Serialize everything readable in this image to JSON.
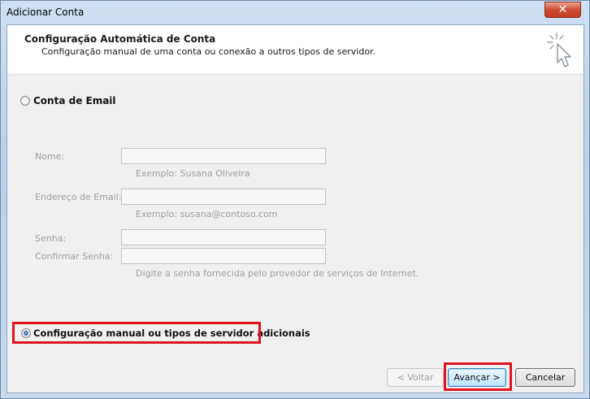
{
  "window": {
    "title": "Adicionar Conta"
  },
  "header": {
    "title": "Configuração Automática de Conta",
    "subtitle": "Configuração manual de uma conta ou conexão a outros tipos de servidor.",
    "icon": "wizard-cursor-icon"
  },
  "options": {
    "email_account": {
      "label": "Conta de Email",
      "selected": false
    },
    "manual_config": {
      "label": "Configuração manual ou tipos de servidor adicionais",
      "selected": true
    }
  },
  "form": {
    "name": {
      "label": "Nome:",
      "value": "",
      "hint": "Exemplo: Susana Oliveira"
    },
    "email": {
      "label": "Endereço de Email:",
      "value": "",
      "hint": "Exemplo: susana@contoso.com"
    },
    "password": {
      "label": "Senha:",
      "value": ""
    },
    "confirm_password": {
      "label": "Confirmar Senha:",
      "value": "",
      "hint": "Digite a senha fornecida pelo provedor de serviços de Internet."
    }
  },
  "buttons": {
    "back": "< Voltar",
    "next": "Avançar >",
    "cancel": "Cancelar"
  },
  "colors": {
    "highlight": "#e2131e",
    "close_button": "#c43c24"
  }
}
